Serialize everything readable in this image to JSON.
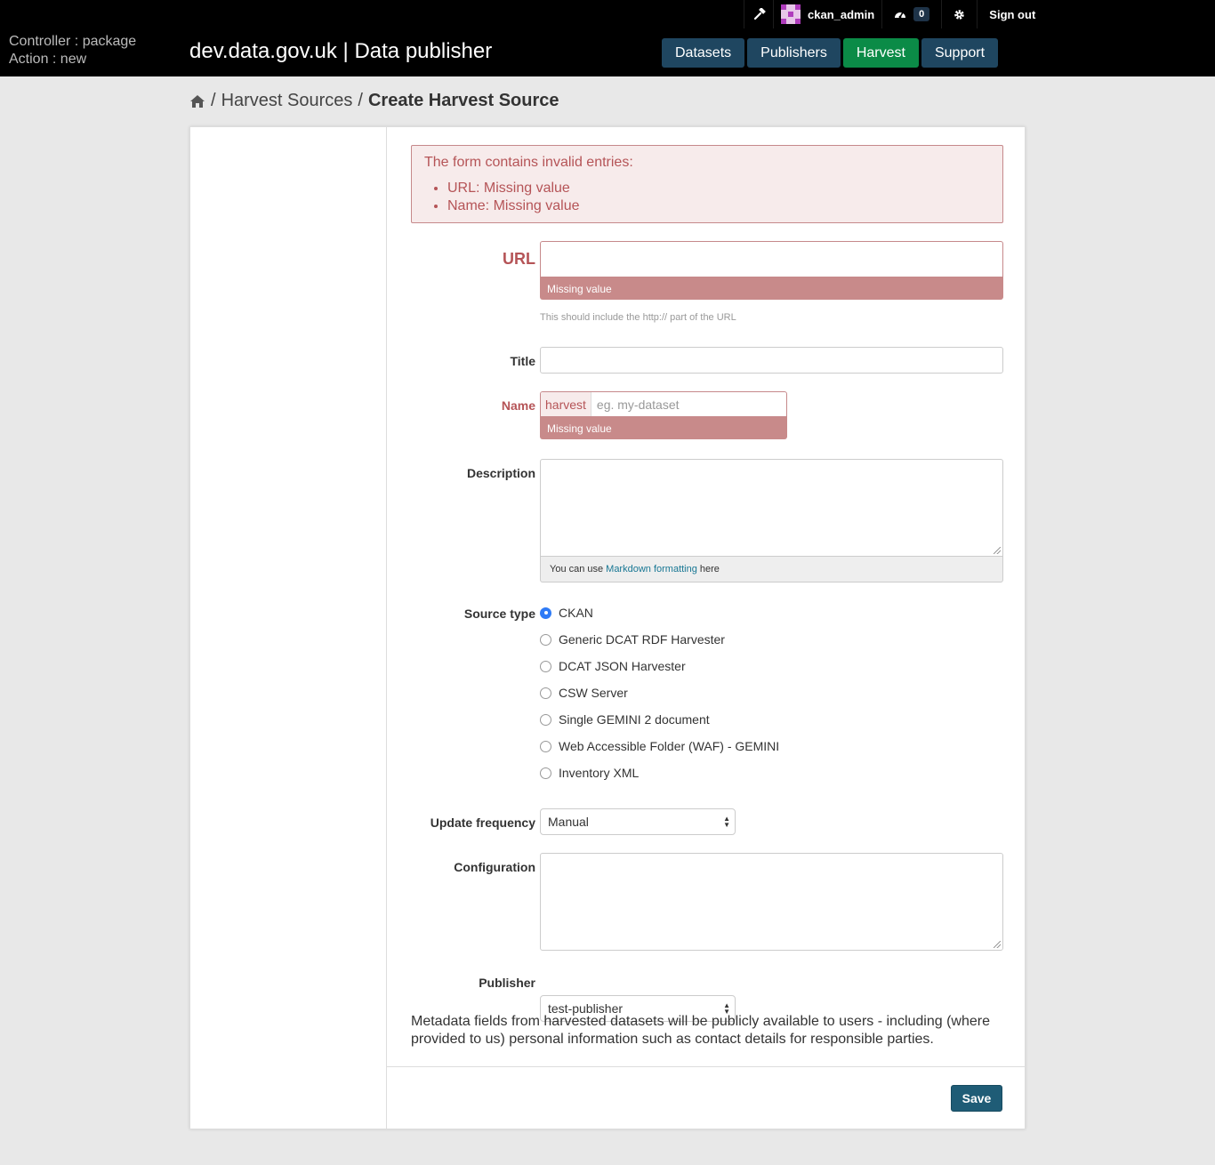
{
  "header": {
    "username": "ckan_admin",
    "dashboard_count": "0",
    "sign_out": "Sign out",
    "debug_controller": "Controller : package",
    "debug_action": "Action : new",
    "site_title": "dev.data.gov.uk | Data publisher",
    "nav": [
      {
        "label": "Datasets",
        "active": false
      },
      {
        "label": "Publishers",
        "active": false
      },
      {
        "label": "Harvest",
        "active": true
      },
      {
        "label": "Support",
        "active": false
      }
    ]
  },
  "breadcrumb": {
    "sep1": "/",
    "parent": "Harvest Sources",
    "sep2": "/",
    "current": "Create Harvest Source"
  },
  "errors": {
    "title": "The form contains invalid entries:",
    "items": [
      "URL: Missing value",
      "Name: Missing value"
    ]
  },
  "form": {
    "url": {
      "label": "URL",
      "value": "",
      "error": "Missing value",
      "help": "This should include the http:// part of the URL"
    },
    "title": {
      "label": "Title",
      "value": ""
    },
    "name": {
      "label": "Name",
      "prefix": "harvest",
      "placeholder": "eg. my-dataset",
      "error": "Missing value"
    },
    "description": {
      "label": "Description",
      "value": "",
      "md_before": "You can use",
      "md_link": "Markdown formatting",
      "md_after": "here"
    },
    "source_type": {
      "label": "Source type",
      "options": [
        {
          "label": "CKAN",
          "checked": true
        },
        {
          "label": "Generic DCAT RDF Harvester",
          "checked": false
        },
        {
          "label": "DCAT JSON Harvester",
          "checked": false
        },
        {
          "label": "CSW Server",
          "checked": false
        },
        {
          "label": "Single GEMINI 2 document",
          "checked": false
        },
        {
          "label": "Web Accessible Folder (WAF) - GEMINI",
          "checked": false
        },
        {
          "label": "Inventory XML",
          "checked": false
        }
      ]
    },
    "update_frequency": {
      "label": "Update frequency",
      "value": "Manual"
    },
    "configuration": {
      "label": "Configuration",
      "value": ""
    },
    "publisher": {
      "label": "Publisher",
      "value": "test-publisher"
    },
    "notice": "Metadata fields from harvested datasets will be publicly available to users - including (where provided to us) personal information such as contact details for responsible parties.",
    "save_label": "Save"
  },
  "colors": {
    "masthead": "#000000",
    "nav_button": "#1f4660",
    "nav_active": "#0b8b47",
    "error_text": "#b55457",
    "error_strip": "#c88a8a",
    "save_button": "#1f5c76"
  }
}
